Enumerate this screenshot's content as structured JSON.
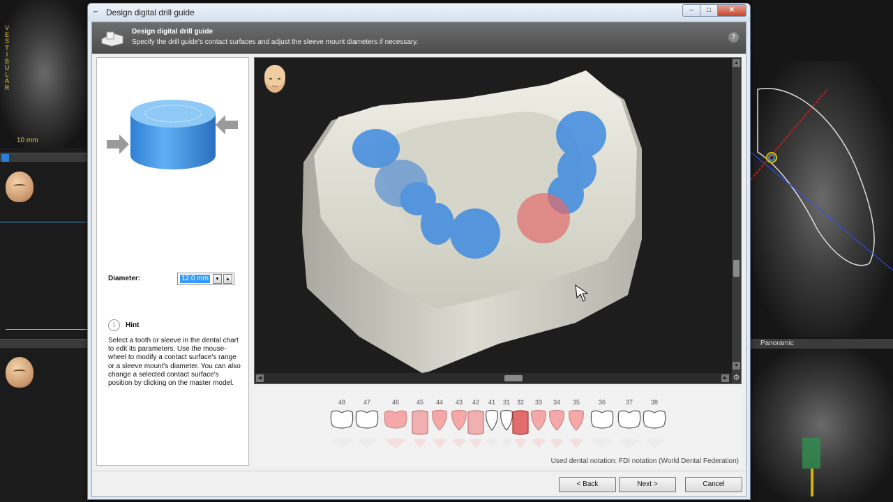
{
  "background": {
    "vestibular_letters": [
      "V",
      "E",
      "S",
      "T",
      "I",
      "B",
      "U",
      "L",
      "A",
      "R"
    ],
    "scale_label": "10 mm",
    "panoramic_title": "Panoramic"
  },
  "window": {
    "title": "Design digital drill guide",
    "minimize": "‒",
    "maximize": "□",
    "close": "✕"
  },
  "header": {
    "title": "Design digital drill guide",
    "subtitle": "Specify the drill guide's contact surfaces and adjust the sleeve mount diameters if necessary.",
    "help": "?"
  },
  "left_panel": {
    "diameter_label": "Diameter:",
    "diameter_value": "12.0 mm",
    "hint_title": "Hint",
    "hint_text": "Select a tooth or sleeve in the dental chart to edit its parameters. Use the mouse-wheel to modify a contact surface's range or a sleeve mount's diameter. You can also change a selected contact surface's position by clicking on the master model."
  },
  "dental_chart": {
    "teeth": [
      {
        "number": "48",
        "state": "normal",
        "shape": "molar"
      },
      {
        "number": "47",
        "state": "normal",
        "shape": "molar"
      },
      {
        "number": "46",
        "state": "contact",
        "shape": "molar"
      },
      {
        "number": "45",
        "state": "sleeve",
        "shape": "sleeve"
      },
      {
        "number": "44",
        "state": "contact",
        "shape": "premolar"
      },
      {
        "number": "43",
        "state": "contact",
        "shape": "canine"
      },
      {
        "number": "42",
        "state": "sleeve",
        "shape": "sleeve"
      },
      {
        "number": "41",
        "state": "normal",
        "shape": "incisor"
      },
      {
        "number": "31",
        "state": "normal",
        "shape": "incisor"
      },
      {
        "number": "32",
        "state": "selected-sleeve",
        "shape": "sleeve"
      },
      {
        "number": "33",
        "state": "contact",
        "shape": "canine"
      },
      {
        "number": "34",
        "state": "contact",
        "shape": "premolar"
      },
      {
        "number": "35",
        "state": "contact",
        "shape": "premolar"
      },
      {
        "number": "36",
        "state": "normal",
        "shape": "molar"
      },
      {
        "number": "37",
        "state": "normal",
        "shape": "molar"
      },
      {
        "number": "38",
        "state": "normal",
        "shape": "molar"
      }
    ],
    "notation": "Used dental notation: FDI notation (World Dental Federation)"
  },
  "footer": {
    "back": "< Back",
    "next": "Next >",
    "cancel": "Cancel"
  },
  "colors": {
    "contact_blue": "#3f8be0",
    "sleeve_red": "#e36b6b",
    "tooth_pink": "#f4a8a8"
  }
}
